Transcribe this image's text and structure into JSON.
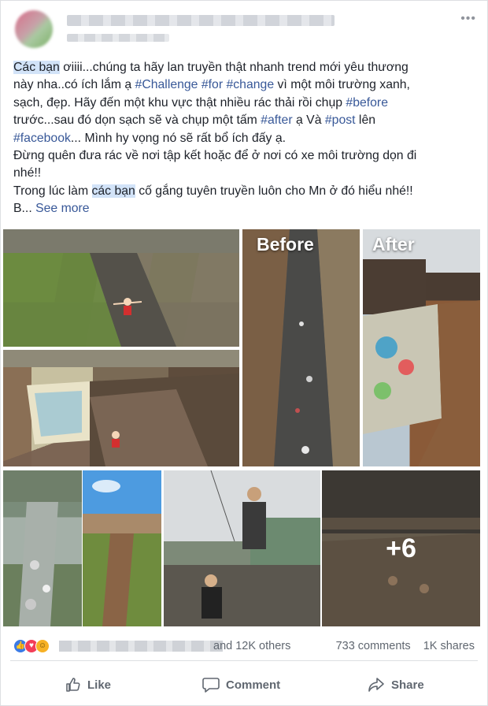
{
  "post": {
    "text_lines": [
      {
        "segments": [
          {
            "t": "Các bạn",
            "style": "hl"
          },
          {
            "t": " ơiiii...chúng ta hãy lan truyền thật nhanh trend mới yêu thương",
            "style": "plain"
          }
        ]
      },
      {
        "segments": [
          {
            "t": "này nha..có ích lắm ạ ",
            "style": "plain"
          },
          {
            "t": "#Challenge",
            "style": "tag"
          },
          {
            "t": " ",
            "style": "plain"
          },
          {
            "t": "#for",
            "style": "tag"
          },
          {
            "t": " ",
            "style": "plain"
          },
          {
            "t": "#change",
            "style": "tag"
          },
          {
            "t": " vì một môi trường xanh,",
            "style": "plain"
          }
        ]
      },
      {
        "segments": [
          {
            "t": "sạch, đẹp. Hãy đến một khu vực thật nhiều rác thải rồi chụp ",
            "style": "plain"
          },
          {
            "t": "#before",
            "style": "tag"
          }
        ]
      },
      {
        "segments": [
          {
            "t": "trước...sau đó dọn sạch sẽ và chụp một tấm ",
            "style": "plain"
          },
          {
            "t": "#after",
            "style": "tag"
          },
          {
            "t": " ạ Và ",
            "style": "plain"
          },
          {
            "t": "#post",
            "style": "tag"
          },
          {
            "t": " lên",
            "style": "plain"
          }
        ]
      },
      {
        "segments": [
          {
            "t": "#facebook",
            "style": "tag"
          },
          {
            "t": "... Mình hy vọng nó sẽ rất bổ ích đấy ạ.",
            "style": "plain"
          }
        ]
      },
      {
        "segments": [
          {
            "t": "Đừng quên đưa rác về nơi tập kết hoặc để ở nơi có xe môi trường dọn đi",
            "style": "plain"
          }
        ]
      },
      {
        "segments": [
          {
            "t": "nhé!!",
            "style": "plain"
          }
        ]
      },
      {
        "segments": [
          {
            "t": "Trong lúc làm ",
            "style": "plain"
          },
          {
            "t": "các bạn",
            "style": "hl"
          },
          {
            "t": " cố gắng tuyên truyền luôn cho Mn ở đó hiểu nhé!!",
            "style": "plain"
          }
        ]
      },
      {
        "segments": [
          {
            "t": "B... ",
            "style": "plain"
          },
          {
            "t": "See more",
            "style": "see-more"
          }
        ]
      }
    ]
  },
  "photos": {
    "before_label": "Before",
    "after_label": "After",
    "more_count": "+6"
  },
  "reactions": {
    "icons": [
      "like-icon",
      "love-icon",
      "haha-icon"
    ],
    "others_text": "and 12K others",
    "comments_text": "733 comments",
    "shares_text": "1K shares"
  },
  "actions": {
    "like": "Like",
    "comment": "Comment",
    "share": "Share"
  },
  "colors": {
    "link": "#385898",
    "highlight": "#d2e3f8",
    "like_blue": "#3b7be5",
    "love_red": "#f33e58",
    "haha_yellow": "#f7b125"
  }
}
